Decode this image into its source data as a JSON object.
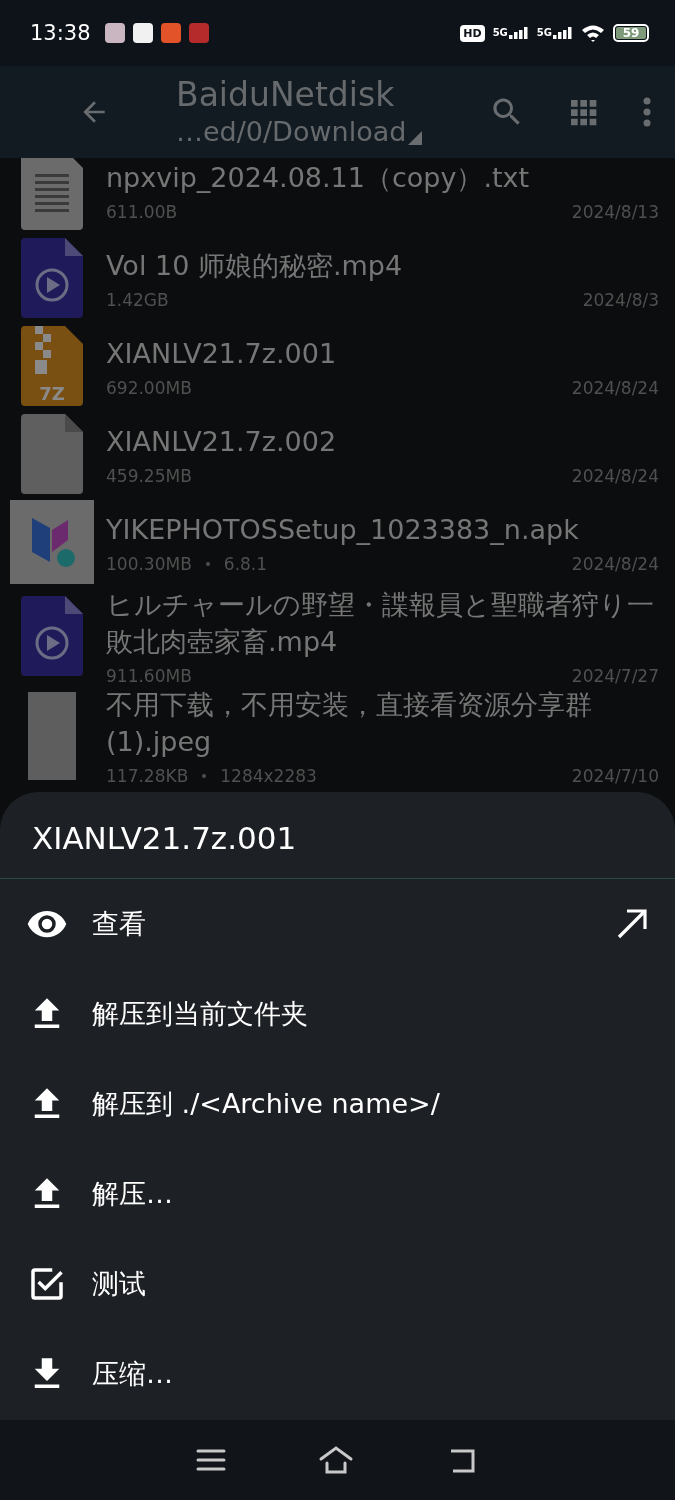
{
  "status_bar": {
    "time": "13:38",
    "hd": "HD",
    "signals": [
      "5G",
      "5G"
    ],
    "battery": "59"
  },
  "toolbar": {
    "title": "BaiduNetdisk",
    "path": "…ed/0/Download"
  },
  "files": [
    {
      "kind": "text",
      "name": "npxvip_2024.08.11（copy）.txt",
      "size": "611.00B",
      "date": "2024/8/13"
    },
    {
      "kind": "video",
      "name": "Vol 10 师娘的秘密.mp4",
      "size": "1.42GB",
      "date": "2024/8/3"
    },
    {
      "kind": "archive",
      "name": "XIANLV21.7z.001",
      "size": "692.00MB",
      "date": "2024/8/24",
      "badge": "7Z"
    },
    {
      "kind": "generic",
      "name": "XIANLV21.7z.002",
      "size": "459.25MB",
      "date": "2024/8/24"
    },
    {
      "kind": "apk",
      "name": "YIKEPHOTOSSetup_1023383_n.apk",
      "size": "100.30MB",
      "extra": "6.8.1",
      "date": "2024/8/24"
    },
    {
      "kind": "video",
      "name": "ヒルチャールの野望・諜報員と聖職者狩り一敗北肉壺家畜.mp4",
      "size": "911.60MB",
      "date": "2024/7/27"
    },
    {
      "kind": "image",
      "name": "不用下载，不用安装，直接看资源分享群(1).jpeg",
      "size": "117.28KB",
      "extra": "1284x2283",
      "date": "2024/7/10"
    }
  ],
  "sheet": {
    "title": "XIANLV21.7z.001",
    "actions": [
      {
        "kind": "view",
        "label": "查看"
      },
      {
        "kind": "extract",
        "label": "解压到当前文件夹"
      },
      {
        "kind": "extract",
        "label": "解压到 ./<Archive name>/"
      },
      {
        "kind": "extract",
        "label": "解压…"
      },
      {
        "kind": "test",
        "label": "测试"
      },
      {
        "kind": "compress",
        "label": "压缩…"
      }
    ]
  }
}
